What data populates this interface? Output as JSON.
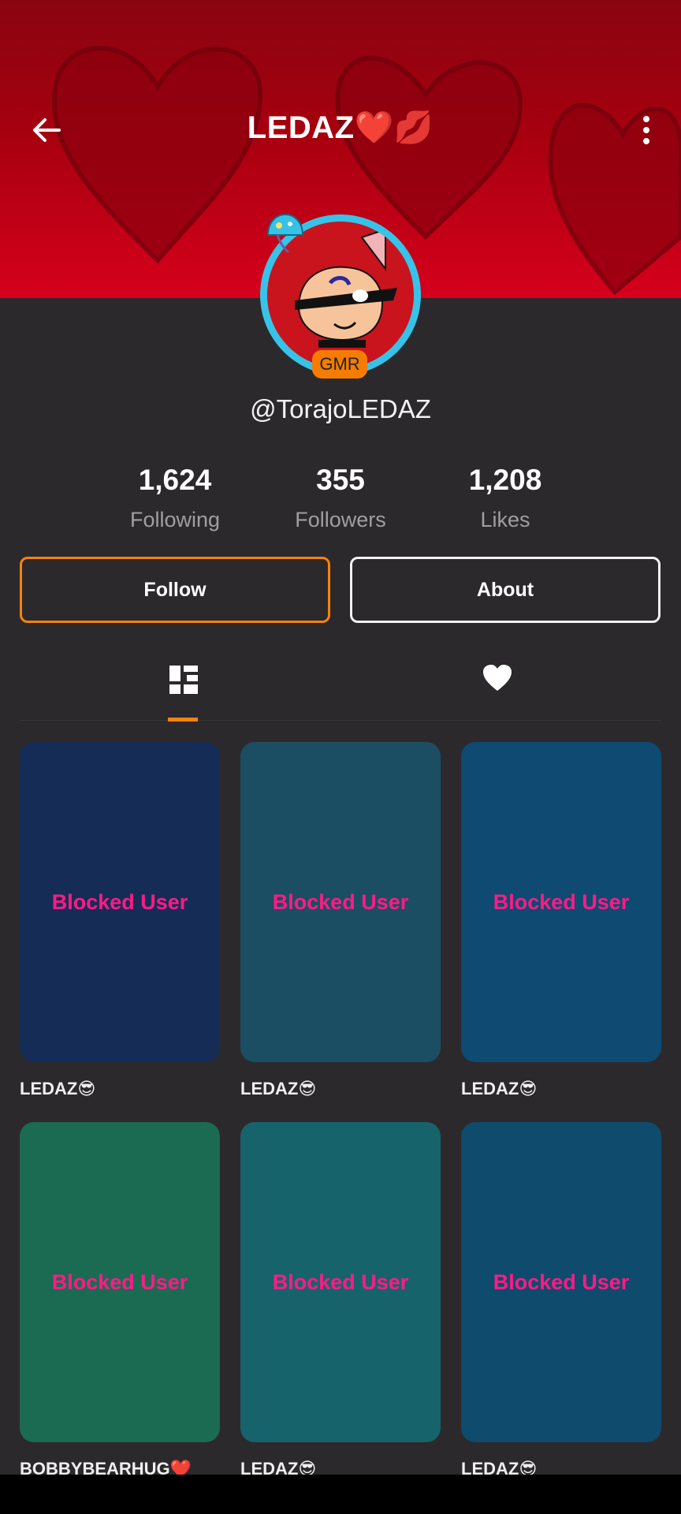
{
  "header": {
    "title": "LEDAZ❤️💋",
    "back_icon": "arrow-left-icon",
    "menu_icon": "more-vertical-icon",
    "banner_color": "#c4001a"
  },
  "profile": {
    "username": "@TorajoLEDAZ",
    "badge": "GMR",
    "ring_color": "#37c3e8"
  },
  "stats": [
    {
      "value": "1,624",
      "label": "Following"
    },
    {
      "value": "355",
      "label": "Followers"
    },
    {
      "value": "1,208",
      "label": "Likes"
    }
  ],
  "actions": {
    "follow_label": "Follow",
    "about_label": "About",
    "accent": "#f7820f"
  },
  "tabs": [
    {
      "icon": "video-grid-icon",
      "selected": true
    },
    {
      "icon": "heart-icon",
      "selected": false
    }
  ],
  "videos": [
    {
      "label": "Blocked User",
      "caption": "LEDAZ😎",
      "color": "#152d56"
    },
    {
      "label": "Blocked User",
      "caption": "LEDAZ😎",
      "color": "#1b4e62"
    },
    {
      "label": "Blocked User",
      "caption": "LEDAZ😎",
      "color": "#0e4a72"
    },
    {
      "label": "Blocked User",
      "caption": "BOBBYBEARHUG❤️",
      "color": "#1b6a52"
    },
    {
      "label": "Blocked User",
      "caption": "LEDAZ😎",
      "color": "#17636b"
    },
    {
      "label": "Blocked User",
      "caption": "LEDAZ😎",
      "color": "#0f4b6d"
    }
  ]
}
